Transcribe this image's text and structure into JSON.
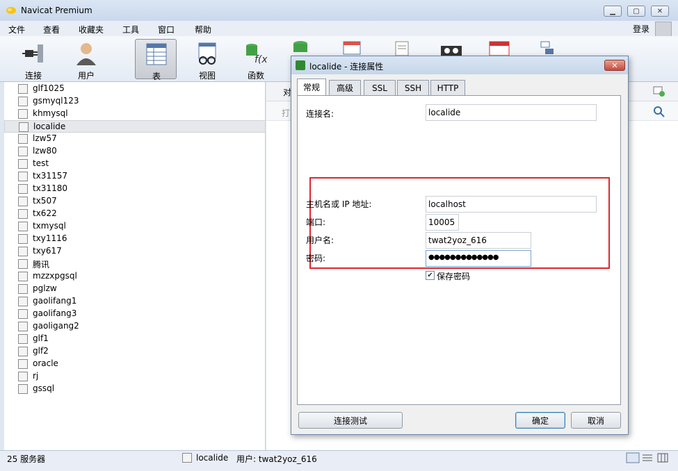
{
  "window": {
    "title": "Navicat Premium"
  },
  "menu": {
    "items": [
      "文件",
      "查看",
      "收藏夹",
      "工具",
      "窗口",
      "帮助"
    ],
    "login": "登录"
  },
  "toolbar": {
    "buttons": [
      "连接",
      "用户",
      "表",
      "视图",
      "函数"
    ],
    "active": "表"
  },
  "sidebar": {
    "connections": [
      "glf1025",
      "gsmyql123",
      "khmysql",
      "localide",
      "lzw57",
      "lzw80",
      "test",
      "tx31157",
      "tx31180",
      "tx507",
      "tx622",
      "txmysql",
      "txy1116",
      "txy617",
      "腾讯",
      "mzzxpgsql",
      "pglzw",
      "gaolifang1",
      "gaolifang3",
      "gaoligang2",
      "glf1",
      "glf2",
      "oracle",
      "rj",
      "gssql"
    ],
    "selected": "localide"
  },
  "rightpane": {
    "partial_text": "对",
    "partial_text2": "打"
  },
  "dialog": {
    "title": "localide - 连接属性",
    "tabs": [
      "常规",
      "高级",
      "SSL",
      "SSH",
      "HTTP"
    ],
    "active_tab": "常规",
    "conn_name_label": "连接名:",
    "conn_name_value": "localide",
    "host_label": "主机名或 IP 地址:",
    "host_value": "localhost",
    "port_label": "端口:",
    "port_value": "10005",
    "user_label": "用户名:",
    "user_value": "twat2yoz_616",
    "password_label": "密码:",
    "password_value": "●●●●●●●●●●●●●",
    "save_password_label": "保存密码",
    "save_password_checked": true,
    "test_button": "连接测试",
    "ok_button": "确定",
    "cancel_button": "取消"
  },
  "status": {
    "server_count": "25 服务器",
    "connection": "localide",
    "user": "用户: twat2yoz_616"
  },
  "colors": {
    "highlight_box": "#e0262d",
    "title_gradient": "#c9d8ec"
  }
}
